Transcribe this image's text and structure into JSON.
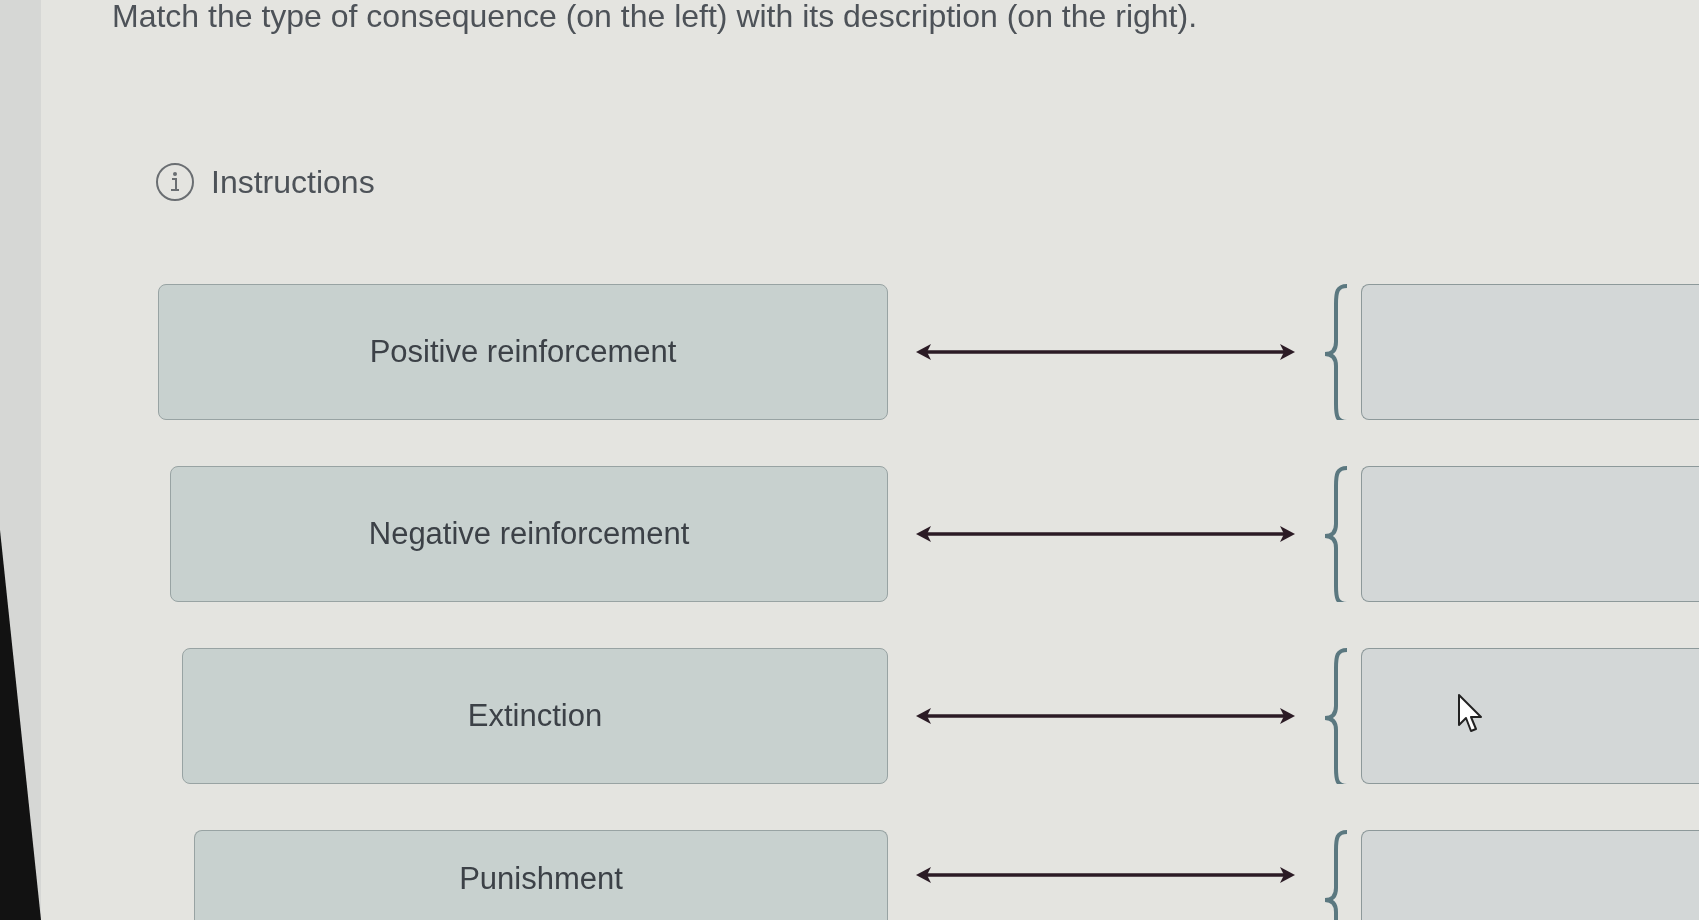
{
  "prompt": "Match the type of consequence (on the left) with its description (on the right).",
  "instructions": {
    "label": "Instructions"
  },
  "pairs": [
    {
      "term": "Positive reinforcement"
    },
    {
      "term": "Negative reinforcement"
    },
    {
      "term": "Extinction"
    },
    {
      "term": "Punishment"
    }
  ]
}
